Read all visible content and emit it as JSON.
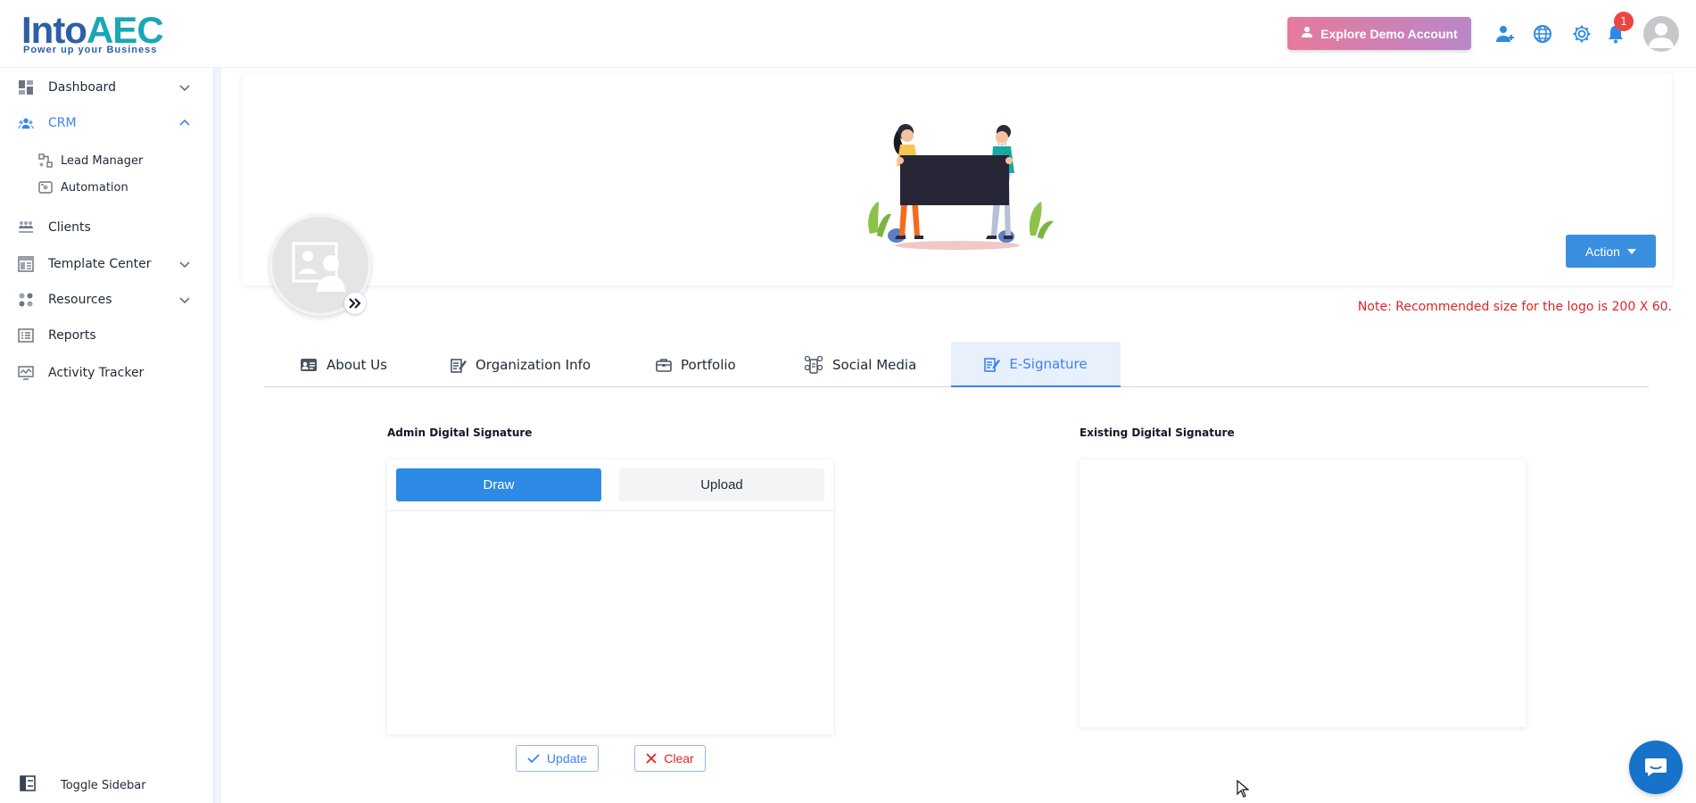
{
  "header": {
    "logo_main": "Into",
    "logo_accent": "AEC",
    "logo_tagline": "Power up your Business",
    "demo_button": "Explore Demo Account",
    "notification_count": "1"
  },
  "sidebar": {
    "items": [
      {
        "label": "Dashboard",
        "icon": "dashboard-icon"
      },
      {
        "label": "CRM",
        "icon": "crm-icon"
      },
      {
        "label": "Clients",
        "icon": "clients-icon"
      },
      {
        "label": "Template Center",
        "icon": "template-icon"
      },
      {
        "label": "Resources",
        "icon": "resources-icon"
      },
      {
        "label": "Reports",
        "icon": "reports-icon"
      },
      {
        "label": "Activity Tracker",
        "icon": "activity-icon"
      }
    ],
    "crm_subitems": [
      {
        "label": "Lead Manager",
        "icon": "lead-manager-icon"
      },
      {
        "label": "Automation",
        "icon": "automation-icon"
      }
    ],
    "toggle_label": "Toggle Sidebar"
  },
  "banner": {
    "action_button": "Action",
    "note": "Note: Recommended size for the logo is 200 X 60."
  },
  "tabs": [
    {
      "label": "About Us",
      "icon": "id-card-icon"
    },
    {
      "label": "Organization Info",
      "icon": "edit-document-icon"
    },
    {
      "label": "Portfolio",
      "icon": "briefcase-icon"
    },
    {
      "label": "Social Media",
      "icon": "social-media-icon"
    },
    {
      "label": "E-Signature",
      "icon": "signature-icon"
    }
  ],
  "signature": {
    "admin_title": "Admin Digital Signature",
    "existing_title": "Existing Digital Signature",
    "draw_label": "Draw",
    "upload_label": "Upload",
    "update_label": "Update",
    "clear_label": "Clear"
  },
  "colors": {
    "accent": "#3b82f6",
    "primary_button": "#2d8ae5",
    "danger": "#dc2626",
    "brand": "#2d5fa6"
  }
}
